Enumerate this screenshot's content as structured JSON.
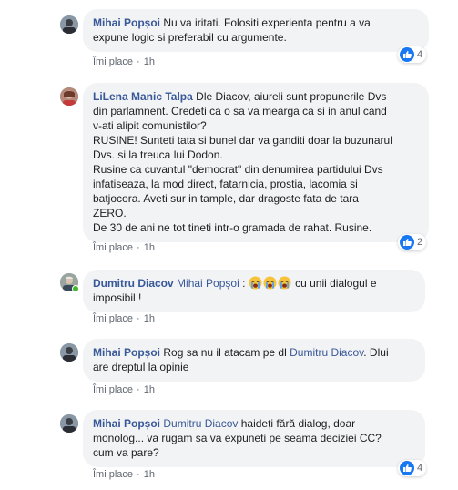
{
  "comments": [
    {
      "author": "Mihai Popșoi",
      "mention": "",
      "lines": [
        "Nu va iritati. Folositi experienta pentru a va",
        "expune logic si preferabil cu argumente."
      ],
      "like_label": "Îmi place",
      "time": "1h",
      "reaction_count": "4"
    },
    {
      "author": "LiLena Manic Talpa",
      "mention": "",
      "lines": [
        "Dle Diacov, aiureli sunt propunerile Dvs",
        "din parlamnent. Credeti ca o sa va mearga ca si in anul cand",
        "v-ati alipit comunistilor?",
        "RUSINE! Sunteti tata si bunel dar va ganditi doar la buzunarul",
        "Dvs. si la treuca lui Dodon.",
        "Rusine ca cuvantul \"democrat\" din denumirea partidului Dvs",
        "infatiseaza, la mod direct, fatarnicia, prostia, lacomia si",
        "batjocora. Aveti sur in tample, dar dragoste fata de tara",
        "ZERO.",
        "De 30 de ani ne tot tineti intr-o gramada de rahat. Rusine."
      ],
      "like_label": "Îmi place",
      "time": "1h",
      "reaction_count": "2"
    },
    {
      "author": "Dumitru Diacov",
      "mention": "Mihai Popșoi",
      "lines": [
        "cu unii dialogul e",
        "imposibil !"
      ],
      "like_label": "Îmi place",
      "time": "1h",
      "reaction_count": ""
    },
    {
      "author": "Mihai Popșoi",
      "mention": "Dumitru Diacov",
      "lines": [
        "Rog sa nu il atacam pe dl",
        ". Dlui",
        "are dreptul la opinie"
      ],
      "like_label": "Îmi place",
      "time": "1h",
      "reaction_count": ""
    },
    {
      "author": "Mihai Popșoi",
      "mention": "Dumitru Diacov",
      "lines": [
        "haideți fără dialog, doar",
        "monolog... va rugam sa va expuneti pe seama deciziei CC?",
        "cum va pare?"
      ],
      "like_label": "Îmi place",
      "time": "1h",
      "reaction_count": "4"
    }
  ],
  "colors": {
    "link": "#385898",
    "bubble": "#f2f3f5",
    "like_blue": "#1877f2",
    "meta": "#606770"
  },
  "icons": {
    "like": "thumbs-up-icon",
    "emoji": "loudly-crying-face-icon"
  }
}
